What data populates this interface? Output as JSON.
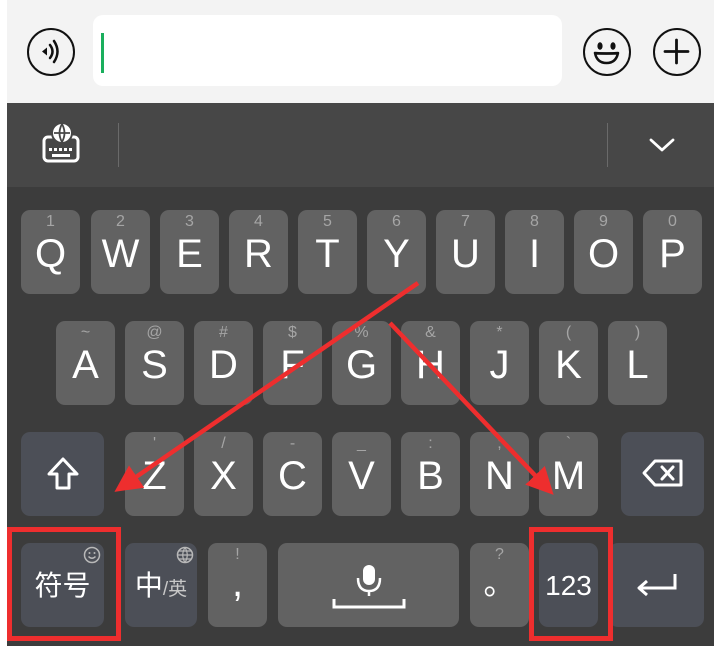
{
  "input_bar": {
    "left_icon": "voice-icon",
    "right_icons": [
      "emoji-icon",
      "plus-icon"
    ],
    "text_value": ""
  },
  "toolbar": {
    "left_icon": "keyboard-settings-globe-icon",
    "right_icon": "chevron-down-icon"
  },
  "keyboard": {
    "row1": [
      {
        "label": "Q",
        "sub": "1"
      },
      {
        "label": "W",
        "sub": "2"
      },
      {
        "label": "E",
        "sub": "3"
      },
      {
        "label": "R",
        "sub": "4"
      },
      {
        "label": "T",
        "sub": "5"
      },
      {
        "label": "Y",
        "sub": "6"
      },
      {
        "label": "U",
        "sub": "7"
      },
      {
        "label": "I",
        "sub": "8"
      },
      {
        "label": "O",
        "sub": "9"
      },
      {
        "label": "P",
        "sub": "0"
      }
    ],
    "row2": [
      {
        "label": "A",
        "sub": "~"
      },
      {
        "label": "S",
        "sub": "@"
      },
      {
        "label": "D",
        "sub": "#"
      },
      {
        "label": "F",
        "sub": "$"
      },
      {
        "label": "G",
        "sub": "%"
      },
      {
        "label": "H",
        "sub": "&"
      },
      {
        "label": "J",
        "sub": "*"
      },
      {
        "label": "K",
        "sub": "("
      },
      {
        "label": "L",
        "sub": ")"
      }
    ],
    "row3": [
      {
        "label": "Z",
        "sub": "'"
      },
      {
        "label": "X",
        "sub": "/"
      },
      {
        "label": "C",
        "sub": "-"
      },
      {
        "label": "V",
        "sub": "_"
      },
      {
        "label": "B",
        "sub": ":"
      },
      {
        "label": "N",
        "sub": ";"
      },
      {
        "label": "M",
        "sub": "`"
      }
    ],
    "shift_icon": "shift-arrow-icon",
    "backspace_icon": "backspace-icon",
    "row4": {
      "symbols": "符号",
      "lang_main": "中",
      "lang_sub": "/英",
      "comma": ",",
      "comma_sub": "!",
      "space_icon": "microphone-icon",
      "period": "。",
      "period_sub": "?",
      "numbers": "123",
      "enter_icon": "enter-arrow-icon"
    }
  },
  "annotations": {
    "highlight_color": "#ee2e2e",
    "highlighted_keys": [
      "符号",
      "123"
    ]
  }
}
